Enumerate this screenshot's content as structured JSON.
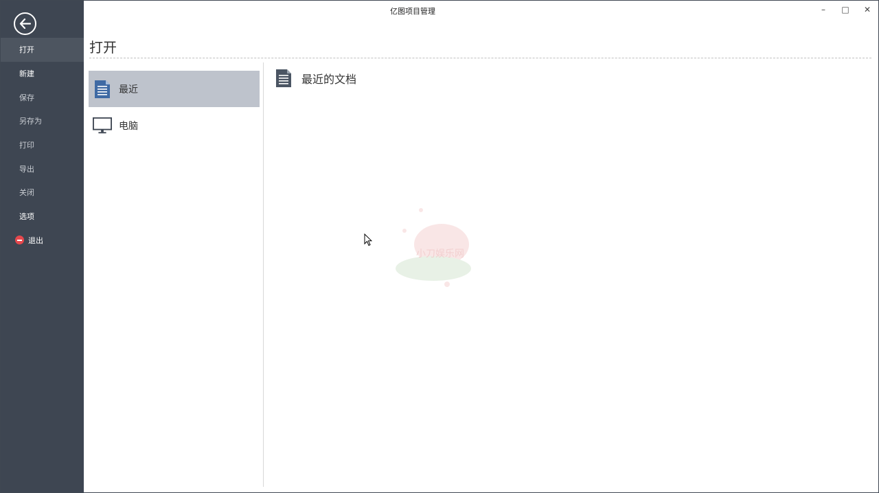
{
  "window": {
    "title": "亿图项目管理",
    "controls": {
      "minimize": "–",
      "maximize": "□",
      "close": "✕"
    }
  },
  "sidebar": {
    "back_icon": "back-arrow-circle-icon",
    "items": [
      {
        "label": "打开",
        "active": true
      },
      {
        "label": "新建"
      },
      {
        "label": "保存"
      },
      {
        "label": "另存为"
      },
      {
        "label": "打印"
      },
      {
        "label": "导出"
      },
      {
        "label": "关闭"
      },
      {
        "label": "选项"
      },
      {
        "label": "退出",
        "icon": "exit-icon"
      }
    ]
  },
  "page": {
    "title": "打开"
  },
  "locations": [
    {
      "label": "最近",
      "icon": "document-icon",
      "selected": true
    },
    {
      "label": "电脑",
      "icon": "monitor-icon"
    }
  ],
  "recent": {
    "header": "最近的文档",
    "icon": "document-list-icon"
  },
  "watermark": {
    "text": "小刀娱乐网"
  },
  "colors": {
    "sidebar_bg": "#3e4652",
    "sidebar_active": "#4d5560",
    "selected_location": "#bec3cc",
    "exit_icon": "#e5484d"
  }
}
